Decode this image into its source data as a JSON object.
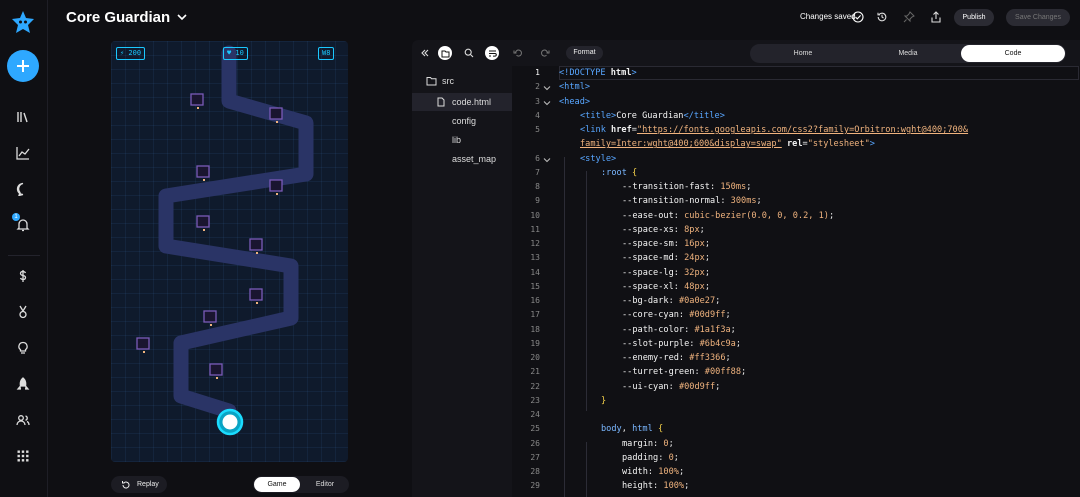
{
  "app": {
    "project_title": "Core Guardian",
    "save_status": "Changes saved",
    "publish_label": "Publish",
    "save_changes_label": "Save Changes"
  },
  "sidebar": {
    "icons": [
      "logo-icon",
      "plus-icon",
      "library-icon",
      "chart-icon",
      "chat-icon",
      "notification-icon",
      "dollar-icon",
      "medal-icon",
      "lightbulb-icon",
      "rocket-icon",
      "users-icon",
      "grid-icon"
    ],
    "notification_badge": "1"
  },
  "game": {
    "hud_left": "⚡ 200",
    "hud_center": "♥ 10",
    "hud_right": "W8",
    "replay_label": "Replay",
    "view_tabs": [
      "Game",
      "Editor"
    ],
    "active_view": "Game"
  },
  "editor": {
    "format_label": "Format",
    "tabs": [
      "Home",
      "Media",
      "Code"
    ],
    "active_tab": "Code",
    "files": [
      {
        "name": "src",
        "type": "folder"
      },
      {
        "name": "code.html",
        "type": "file",
        "active": true
      },
      {
        "name": "config",
        "type": "file"
      },
      {
        "name": "lib",
        "type": "file"
      },
      {
        "name": "asset_map",
        "type": "file"
      }
    ],
    "line_numbers": [
      "1",
      "2",
      "3",
      "4",
      "5",
      "",
      "6",
      "7",
      "8",
      "9",
      "10",
      "11",
      "12",
      "13",
      "14",
      "15",
      "16",
      "17",
      "18",
      "19",
      "20",
      "21",
      "22",
      "23",
      "24",
      "25",
      "26",
      "27",
      "28",
      "29"
    ],
    "code": {
      "l1": [
        "<!DOCTYPE ",
        "html",
        ">"
      ],
      "l2": "<html>",
      "l3": "<head>",
      "l4": [
        "<title>",
        "Core Guardian",
        "</title>"
      ],
      "l5a": [
        "<link ",
        "href",
        "=",
        "\"https://fonts.googleapis.com/css2?family=Orbitron:wght@400;700&"
      ],
      "l5b": [
        "family=Inter:wght@400;600&display=swap\"",
        " ",
        "rel",
        "=",
        "\"stylesheet\"",
        ">"
      ],
      "l6": "<style>",
      "l7": [
        ":root",
        " {"
      ],
      "vars": [
        [
          "--transition-fast",
          "150ms"
        ],
        [
          "--transition-normal",
          "300ms"
        ],
        [
          "--ease-out",
          "cubic-bezier(0.0, 0, 0.2, 1)"
        ],
        [
          "--space-xs",
          "8px"
        ],
        [
          "--space-sm",
          "16px"
        ],
        [
          "--space-md",
          "24px"
        ],
        [
          "--space-lg",
          "32px"
        ],
        [
          "--space-xl",
          "48px"
        ],
        [
          "--bg-dark",
          "#0a0e27"
        ],
        [
          "--core-cyan",
          "#00d9ff"
        ],
        [
          "--path-color",
          "#1a1f3a"
        ],
        [
          "--slot-purple",
          "#6b4c9a"
        ],
        [
          "--enemy-red",
          "#ff3366"
        ],
        [
          "--turret-green",
          "#00ff88"
        ],
        [
          "--ui-cyan",
          "#00d9ff"
        ]
      ],
      "l23": "}",
      "l25": [
        "body",
        ", ",
        "html",
        " {"
      ],
      "props": [
        [
          "margin",
          "0"
        ],
        [
          "padding",
          "0"
        ],
        [
          "width",
          "100%"
        ],
        [
          "height",
          "100%"
        ]
      ]
    }
  },
  "colors": {
    "accent": "#2ea8ff",
    "core": "#00d9ff",
    "path": "#2a3466",
    "slot": "#7a5ab8"
  }
}
